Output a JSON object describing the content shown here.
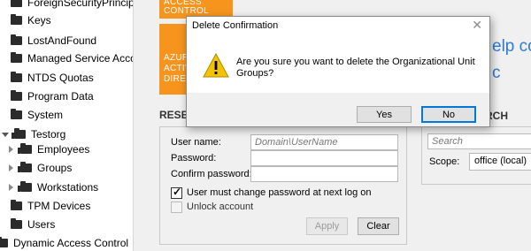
{
  "tree": {
    "items": [
      {
        "label": "ForeignSecurityPrincipals",
        "icon": "folder-icon"
      },
      {
        "label": "Keys",
        "icon": "folder-icon"
      },
      {
        "label": "LostAndFound",
        "icon": "folder-icon"
      },
      {
        "label": "Managed Service Accoun",
        "icon": "folder-icon"
      },
      {
        "label": "NTDS Quotas",
        "icon": "folder-icon"
      },
      {
        "label": "Program Data",
        "icon": "folder-icon"
      },
      {
        "label": "System",
        "icon": "folder-icon"
      },
      {
        "label": "Testorg",
        "icon": "ou-icon"
      },
      {
        "label": "Employees",
        "icon": "ou-icon"
      },
      {
        "label": "Groups",
        "icon": "ou-icon"
      },
      {
        "label": "Workstations",
        "icon": "ou-icon"
      },
      {
        "label": "TPM Devices",
        "icon": "folder-icon"
      },
      {
        "label": "Users",
        "icon": "folder-icon"
      },
      {
        "label": "Dynamic Access Control",
        "icon": "folder-icon"
      }
    ]
  },
  "tiles": {
    "top": "ACCESS CONTROL",
    "azure_line1": "AZUR",
    "azure_line2": "ACTIV",
    "azure_line3": "DIREC"
  },
  "reset": {
    "title": "RESET",
    "username_label": "User name:",
    "username_placeholder": "Domain\\UserName",
    "password_label": "Password:",
    "confirm_label": "Confirm password:",
    "must_change_label": "User must change password at next log on",
    "must_change_checked": true,
    "unlock_label": "Unlock account",
    "apply_label": "Apply",
    "clear_label": "Clear"
  },
  "search": {
    "help_text": "elp co",
    "help_text2": "c",
    "title": "RCH",
    "placeholder": "Search",
    "scope_label": "Scope:",
    "scope_value": "office (local)"
  },
  "dialog": {
    "title": "Delete Confirmation",
    "close_glyph": "✕",
    "message": "Are you sure you want to delete the Organizational Unit Groups?",
    "yes_label": "Yes",
    "no_label": "No",
    "icon": "warning-icon"
  },
  "colors": {
    "tile_orange": "#f7941e",
    "link_blue": "#2c7bd6",
    "default_button_border": "#0078d7",
    "warning_yellow": "#f4c400"
  }
}
